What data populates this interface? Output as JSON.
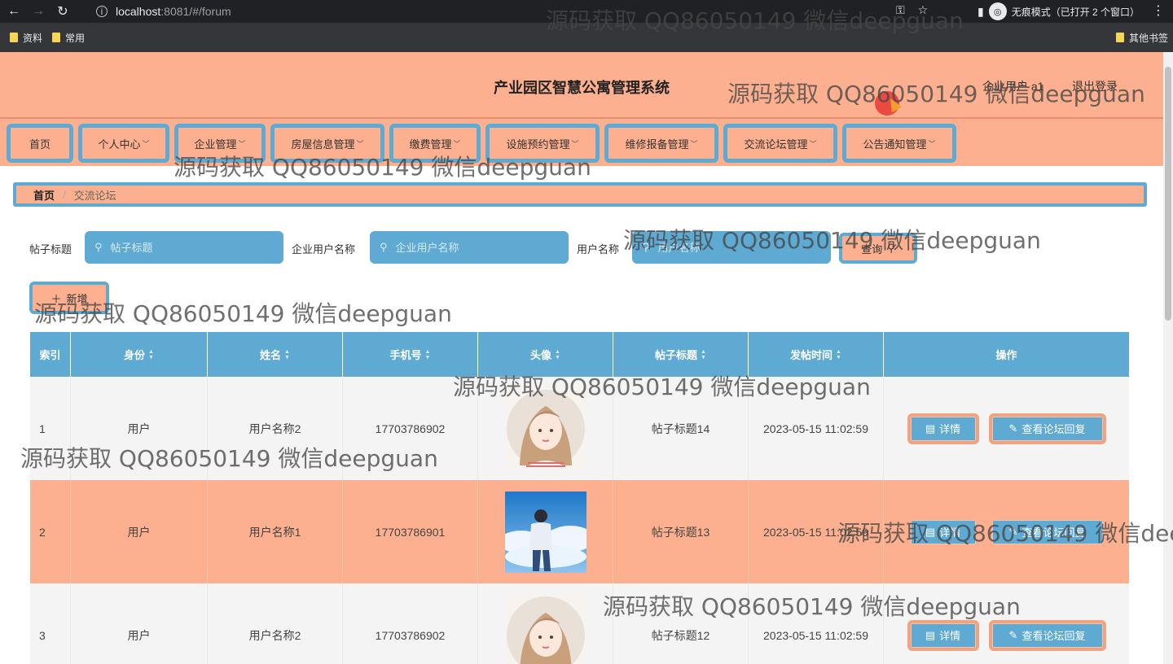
{
  "browser": {
    "url_host": "localhost",
    "url_path": ":8081/#/forum",
    "incognito_label": "无痕模式（已打开 2 个窗口）",
    "bookmarks": [
      "资料",
      "常用"
    ],
    "other_bookmarks": "其他书签"
  },
  "header": {
    "title": "产业园区智慧公寓管理系统",
    "user_text": "企业用户 a1",
    "logout": "退出登录"
  },
  "nav": {
    "items": [
      {
        "label": "首页",
        "has_dropdown": false
      },
      {
        "label": "个人中心",
        "has_dropdown": true
      },
      {
        "label": "企业管理",
        "has_dropdown": true
      },
      {
        "label": "房屋信息管理",
        "has_dropdown": true
      },
      {
        "label": "缴费管理",
        "has_dropdown": true
      },
      {
        "label": "设施预约管理",
        "has_dropdown": true
      },
      {
        "label": "维修报备管理",
        "has_dropdown": true
      },
      {
        "label": "交流论坛管理",
        "has_dropdown": true
      },
      {
        "label": "公告通知管理",
        "has_dropdown": true
      }
    ]
  },
  "breadcrumb": {
    "home": "首页",
    "current": "交流论坛"
  },
  "search": {
    "title_label": "帖子标题",
    "title_placeholder": "帖子标题",
    "company_label": "企业用户名称",
    "company_placeholder": "企业用户名称",
    "user_label": "用户名称",
    "user_placeholder": "用户名称",
    "query_button": "查询"
  },
  "actions": {
    "add_button": "新增"
  },
  "table": {
    "columns": [
      "索引",
      "身份",
      "姓名",
      "手机号",
      "头像",
      "帖子标题",
      "发帖时间",
      "操作"
    ],
    "rows": [
      {
        "index": "1",
        "role": "用户",
        "name": "用户名称2",
        "phone": "17703786902",
        "avatar": "girl",
        "title": "帖子标题14",
        "time": "2023-05-15 11:02:59"
      },
      {
        "index": "2",
        "role": "用户",
        "name": "用户名称1",
        "phone": "17703786901",
        "avatar": "boy",
        "title": "帖子标题13",
        "time": "2023-05-15 11:02:59"
      },
      {
        "index": "3",
        "role": "用户",
        "name": "用户名称2",
        "phone": "17703786902",
        "avatar": "girl",
        "title": "帖子标题12",
        "time": "2023-05-15 11:02:59"
      }
    ],
    "detail_button": "详情",
    "reply_button": "查看论坛回复"
  },
  "watermark": "源码获取 QQ86050149 微信deepguan",
  "colors": {
    "accent_blue": "#5eaad3",
    "accent_salmon": "#fdb08f"
  }
}
